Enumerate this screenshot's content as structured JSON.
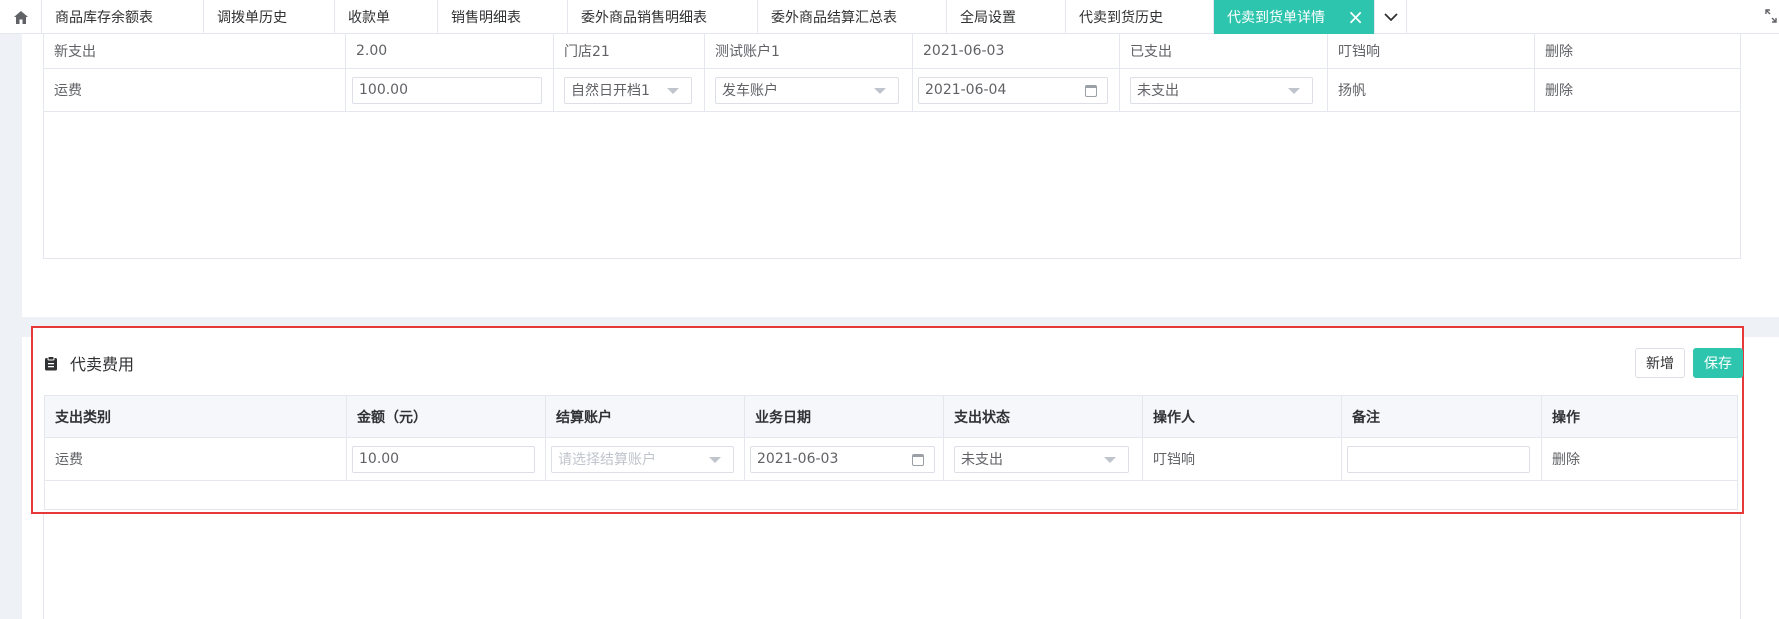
{
  "tabs": [
    {
      "label": "商品库存余额表"
    },
    {
      "label": "调拨单历史"
    },
    {
      "label": "收款单"
    },
    {
      "label": "销售明细表"
    },
    {
      "label": "委外商品销售明细表"
    },
    {
      "label": "委外商品结算汇总表"
    },
    {
      "label": "全局设置"
    },
    {
      "label": "代卖到货历史"
    },
    {
      "label": "代卖到货单详情"
    }
  ],
  "upper": {
    "rows": [
      {
        "category": "新支出",
        "amount": "2.00",
        "store": "门店21",
        "account": "测试账户1",
        "date": "2021-06-03",
        "status": "已支出",
        "operator": "叮铛响",
        "action": "删除"
      },
      {
        "category": "运费",
        "amount": "100.00",
        "store": "自然日开档1",
        "account": "发车账户",
        "date": "2021-06-04",
        "status": "未支出",
        "operator": "扬帆",
        "action": "删除"
      }
    ]
  },
  "section": {
    "title": "代卖费用",
    "add_label": "新增",
    "save_label": "保存",
    "headers": [
      "支出类别",
      "金额（元）",
      "结算账户",
      "业务日期",
      "支出状态",
      "操作人",
      "备注",
      "操作"
    ],
    "row": {
      "category": "运费",
      "amount": "10.00",
      "account_placeholder": "请选择结算账户",
      "date": "2021-06-03",
      "status": "未支出",
      "operator": "叮铛响",
      "remark": "",
      "action": "删除"
    }
  },
  "colors": {
    "accent": "#2ec5ae",
    "highlight_border": "#e63a3a"
  },
  "icons": {
    "home": "home-icon",
    "close": "close-icon",
    "more": "chevron-down-icon",
    "fullscreen": "fullscreen-icon",
    "section": "clipboard-icon",
    "calendar": "calendar-icon",
    "select": "caret-down-icon"
  }
}
